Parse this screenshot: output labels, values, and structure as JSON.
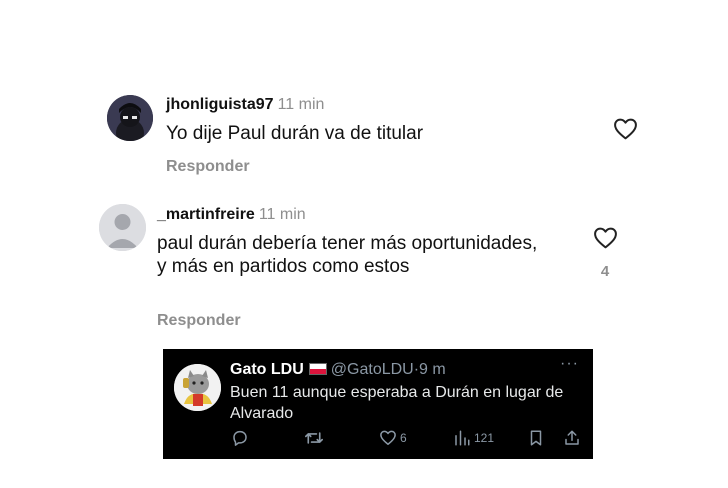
{
  "comments": [
    {
      "username": "jhonliguista97",
      "time": "11 min",
      "text": "Yo dije Paul durán va de titular",
      "reply_label": "Responder",
      "likes": ""
    },
    {
      "username": "_martinfreire",
      "time": "11 min",
      "text": "paul durán debería tener más oportunidades, y más en partidos como estos",
      "reply_label": "Responder",
      "likes": "4"
    }
  ],
  "tweet": {
    "name": "Gato LDU",
    "flag": "Poland flag",
    "handle": "@GatoLDU",
    "separator": "·",
    "time": "9 m",
    "text": "Buen 11 aunque esperaba a Durán en lugar de Alvarado",
    "more": "···",
    "actions": {
      "reply_count": "",
      "retweet_count": "",
      "like_count": "6",
      "views_count": "121"
    }
  },
  "colors": {
    "background": "#ffffff",
    "muted_text": "#8e8e8e",
    "tweet_background": "#000000",
    "tweet_muted": "#8b98a5"
  }
}
